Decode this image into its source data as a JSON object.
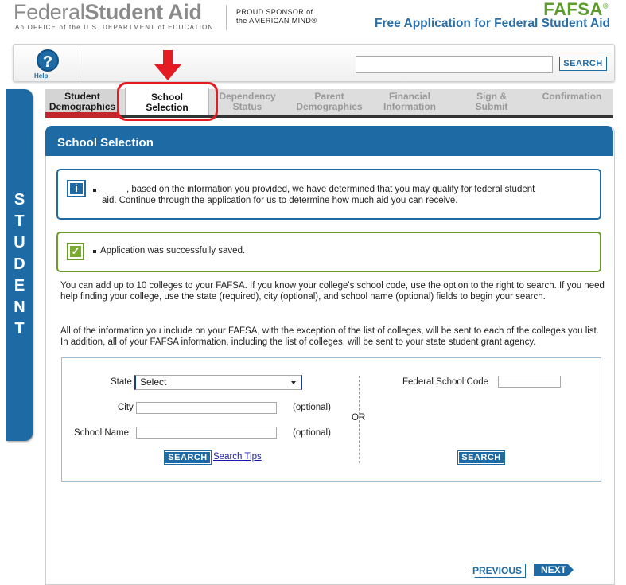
{
  "header": {
    "logo_federal": "Federal",
    "logo_student_aid": "Student Aid",
    "logo_sub_a": "An OFFICE of the U.S. DEPARTMENT of EDUCATION",
    "sponsor_line1": "PROUD SPONSOR of",
    "sponsor_line2": "the AMERICAN MIND®",
    "fafsa": "FAFSA",
    "fafsa_mark": "®",
    "fafsa_sub": "Free Application for Federal Student Aid"
  },
  "toolbar": {
    "help_glyph": "?",
    "help_label": "Help",
    "search_placeholder": "",
    "search_label": "SEARCH"
  },
  "side_label": [
    "S",
    "T",
    "U",
    "D",
    "E",
    "N",
    "T"
  ],
  "tabs": [
    {
      "line1": "Student",
      "line2": "Demographics",
      "state": "done"
    },
    {
      "line1": "School",
      "line2": "Selection",
      "state": "active"
    },
    {
      "line1": "Dependency",
      "line2": "Status",
      "state": "disabled"
    },
    {
      "line1": "Parent",
      "line2": "Demographics",
      "state": "disabled"
    },
    {
      "line1": "Financial",
      "line2": "Information",
      "state": "disabled"
    },
    {
      "line1": "Sign &",
      "line2": "Submit",
      "state": "disabled"
    },
    {
      "line1": "Confirmation",
      "line2": "",
      "state": "disabled"
    }
  ],
  "panel": {
    "title": "School Selection",
    "info_glyph": "i",
    "info_line1": ", based on the information you provided, we have determined that you may qualify for federal student",
    "info_line2": "aid. Continue through the application for us to determine how much aid you can receive.",
    "ok_glyph": "✓",
    "ok_message": "Application was successfully saved.",
    "para1": "You can add up to 10 colleges to your FAFSA. If you know your college's school code, use the option to the right to search. If you need help finding your college, use the state (required), city (optional), and school name (optional) fields to begin your search.",
    "para2": "All of the information you include on your FAFSA, with the exception of the list of colleges, will be sent to each of the colleges you list. In addition, all of your FAFSA information, including the list of colleges, will be sent to your state student grant agency."
  },
  "search_form": {
    "state_label": "State",
    "state_value": "Select",
    "city_label": "City",
    "city_value": "",
    "city_hint": "(optional)",
    "school_label": "School Name",
    "school_value": "",
    "school_hint": "(optional)",
    "or_label": "OR",
    "search_btn": "SEARCH",
    "search_tips": "Search Tips",
    "fsc_label": "Federal School Code",
    "fsc_value": "",
    "fsc_search_btn": "SEARCH"
  },
  "nav": {
    "previous": "PREVIOUS",
    "next": "NEXT"
  },
  "colors": {
    "brand_blue": "#1d6aa5",
    "fafsa_green": "#5c9c2a",
    "highlight_red": "#e31b23"
  }
}
